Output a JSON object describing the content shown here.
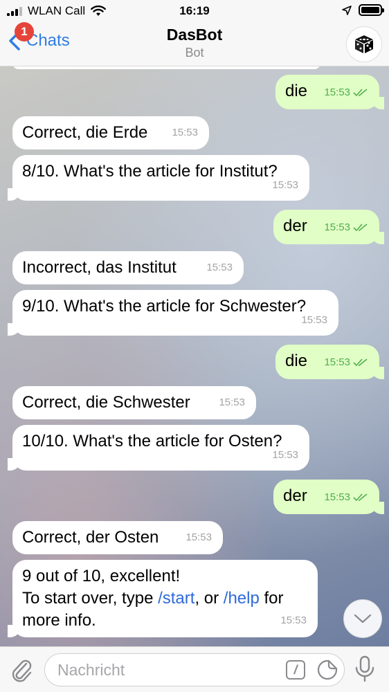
{
  "status_bar": {
    "carrier": "WLAN Call",
    "time": "16:19"
  },
  "header": {
    "back_label": "Chats",
    "unread_badge": "1",
    "title": "DasBot",
    "subtitle": "Bot"
  },
  "messages": [
    {
      "dir": "out",
      "text": "die",
      "time": "15:53"
    },
    {
      "dir": "in",
      "text": "Correct, die Erde",
      "time": "15:53"
    },
    {
      "dir": "in",
      "text": "8/10. What's the article for Institut?",
      "time": "15:53"
    },
    {
      "dir": "out",
      "text": "der",
      "time": "15:53"
    },
    {
      "dir": "in",
      "text": "Incorrect, das Institut",
      "time": "15:53"
    },
    {
      "dir": "in",
      "text": "9/10. What's the article for Schwester?",
      "time": "15:53"
    },
    {
      "dir": "out",
      "text": "die",
      "time": "15:53"
    },
    {
      "dir": "in",
      "text": "Correct, die Schwester",
      "time": "15:53"
    },
    {
      "dir": "in",
      "text": "10/10. What's the article for Osten?",
      "time": "15:53"
    },
    {
      "dir": "out",
      "text": "der",
      "time": "15:53"
    },
    {
      "dir": "in",
      "text": "Correct, der Osten",
      "time": "15:53"
    },
    {
      "dir": "in",
      "line1": "9 out of 10, excellent!",
      "line2_pre": "To start over, type ",
      "link1": "/start",
      "line2_mid": ", or ",
      "link2": "/help",
      "line2_post": " for",
      "line3": "more info.",
      "time": "15:53"
    }
  ],
  "input": {
    "placeholder": "Nachricht"
  },
  "colors": {
    "accent": "#2f7de1",
    "outgoing_bubble": "#e1fec6",
    "outgoing_time": "#4fae4e",
    "badge": "#e5443b"
  }
}
